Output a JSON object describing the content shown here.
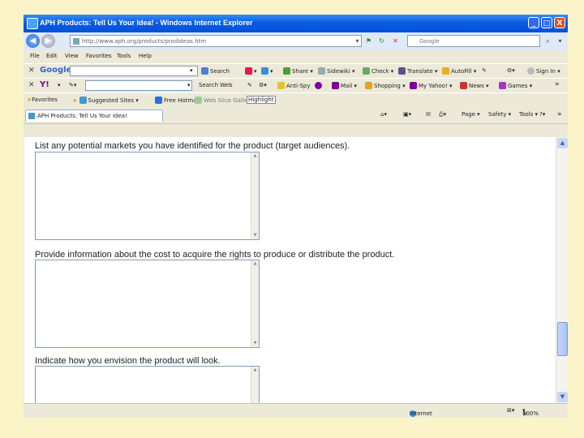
{
  "window": {
    "title": "APH Products: Tell Us Your Idea! - Windows Internet Explorer",
    "buttons": {
      "minimize": "_",
      "maximize": "□",
      "close": "X"
    }
  },
  "address_bar": {
    "url": "http://www.aph.org/products/prodideas.htm",
    "search_placeholder": "Google"
  },
  "menu": [
    "File",
    "Edit",
    "View",
    "Favorites",
    "Tools",
    "Help"
  ],
  "google_toolbar": {
    "logo": "Google",
    "items": [
      "Search",
      "Share",
      "Sidewiki",
      "Check",
      "Translate",
      "AutoFill",
      "Sign In"
    ]
  },
  "yahoo_toolbar": {
    "search_web": "Search Web",
    "items": [
      "Anti-Spy",
      "Mail",
      "Shopping",
      "My Yahoo!",
      "News",
      "Games"
    ],
    "more": "»"
  },
  "favorites_bar": {
    "favorites": "Favorites",
    "items": [
      "Suggested Sites",
      "Free Hotmail",
      "Web Slice Gallery"
    ],
    "highlight": "Highlight"
  },
  "tab": {
    "title": "APH Products: Tell Us Your Idea!"
  },
  "command_bar": {
    "page": "Page",
    "safety": "Safety",
    "tools": "Tools",
    "more": "»"
  },
  "form": {
    "questions": [
      "List any potential markets you have identified for the product (target audiences).",
      "Provide information about the cost to acquire the rights to produce or distribute the product.",
      "Indicate how you envision the product will look."
    ]
  },
  "status_bar": {
    "zone": "Internet",
    "zoom": "100%"
  },
  "colors": {
    "background": "#fbf4c9",
    "titlebar": "#0a5de0",
    "chrome": "#ece9d8"
  },
  "icons": [
    "back-icon",
    "forward-icon",
    "refresh-icon",
    "stop-icon",
    "home-icon",
    "print-icon",
    "help-icon",
    "globe-icon"
  ]
}
